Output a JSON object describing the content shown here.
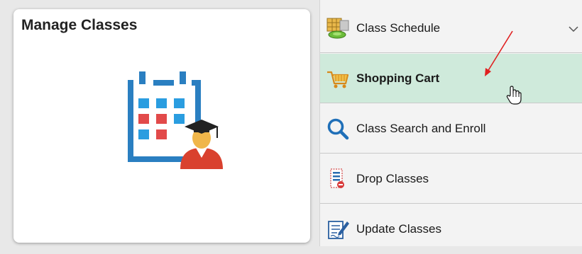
{
  "tile": {
    "title": "Manage Classes",
    "icon": "calendar-graduate-icon"
  },
  "menu": {
    "items": [
      {
        "label": "Class Schedule",
        "icon": "class-schedule-icon",
        "active": false
      },
      {
        "label": "Shopping Cart",
        "icon": "shopping-cart-icon",
        "active": true
      },
      {
        "label": "Class Search and Enroll",
        "icon": "search-icon",
        "active": false
      },
      {
        "label": "Drop Classes",
        "icon": "drop-classes-icon",
        "active": false
      },
      {
        "label": "Update Classes",
        "icon": "update-classes-icon",
        "active": false
      }
    ]
  },
  "colors": {
    "active_row": "#cfeadb",
    "annotation_arrow": "#e02020",
    "accent_blue": "#2a7fc1"
  }
}
